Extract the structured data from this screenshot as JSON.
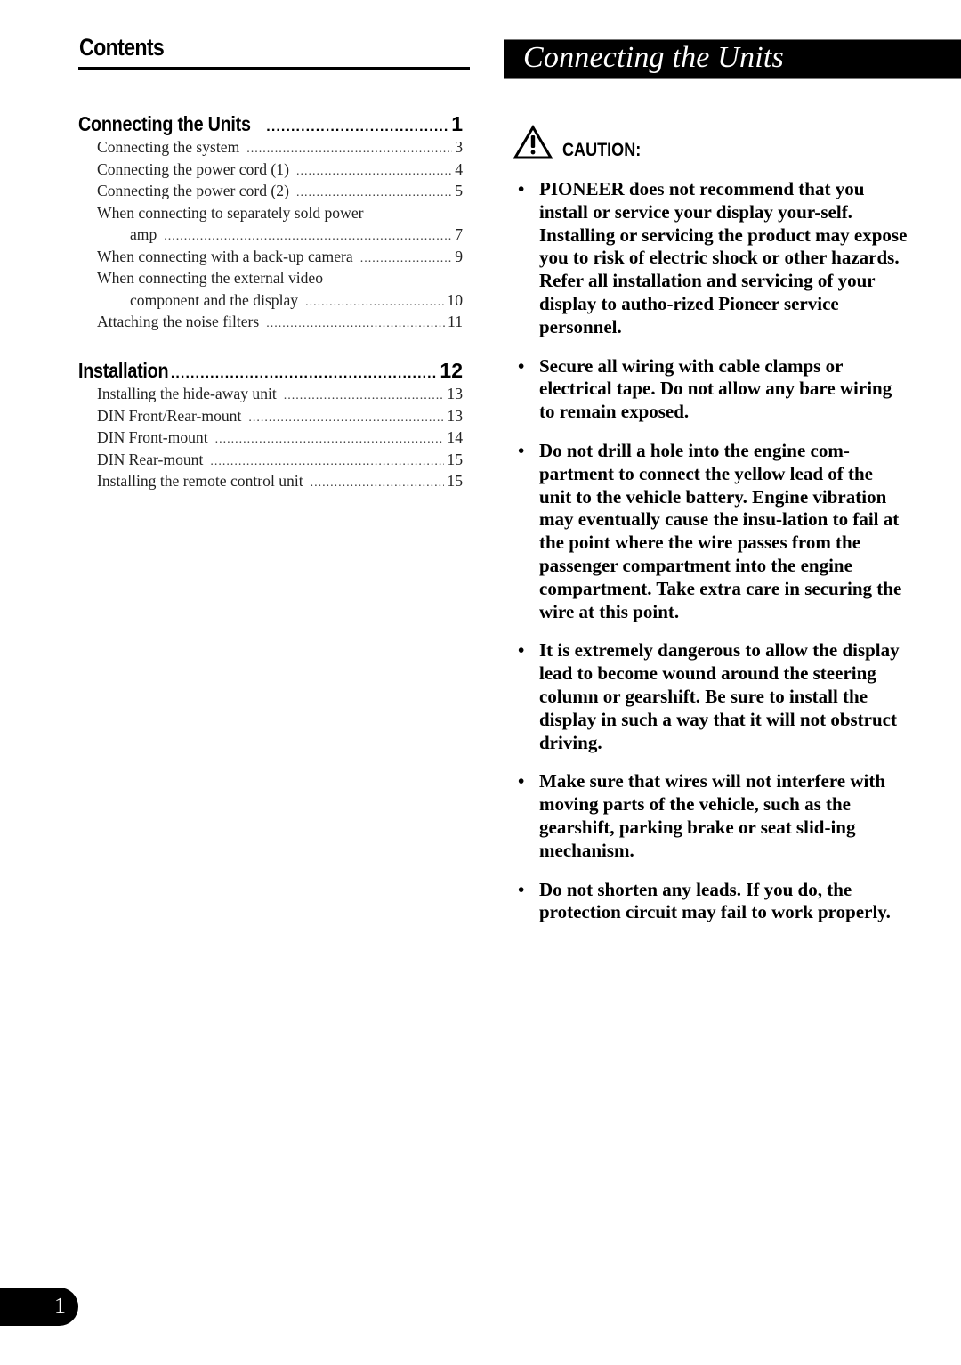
{
  "contents": {
    "title": "Contents",
    "sections": [
      {
        "title": "Connecting the Units",
        "page": "1",
        "items": [
          {
            "label": "Connecting the system",
            "page": "3"
          },
          {
            "label": "Connecting the power cord (1)",
            "page": "4"
          },
          {
            "label": "Connecting the power cord (2)",
            "page": "5"
          },
          {
            "label": "When connecting to separately sold power",
            "continuation": "amp",
            "page": "7"
          },
          {
            "label": "When connecting with a back-up camera",
            "page": "9"
          },
          {
            "label": "When connecting the external video",
            "continuation": "component and the display",
            "page": "10"
          },
          {
            "label": "Attaching the noise filters",
            "page": "11"
          }
        ]
      },
      {
        "title": "Installation",
        "page": "12",
        "items": [
          {
            "label": "Installing the hide-away unit",
            "page": "13"
          },
          {
            "label": "DIN Front/Rear-mount",
            "page": "13"
          },
          {
            "label": "DIN Front-mount",
            "page": "14"
          },
          {
            "label": "DIN Rear-mount",
            "page": "15"
          },
          {
            "label": "Installing the remote control unit",
            "page": "15"
          }
        ]
      }
    ]
  },
  "section_header": {
    "title": "Connecting the Units"
  },
  "caution": {
    "icon": "warning-triangle-icon",
    "label": "CAUTION:",
    "bullet_glyph": "•",
    "items": [
      "PIONEER does not recommend that you install or service your display your-self. Installing or servicing the product may expose you to risk of electric shock or other hazards. Refer all installation and servicing of your display to autho-rized Pioneer service personnel.",
      "Secure all wiring with cable clamps or electrical tape. Do not allow any bare wiring to remain exposed.",
      "Do not drill a hole into the engine com-partment to connect the yellow lead of the unit to the vehicle battery. Engine vibration may eventually cause the insu-lation to fail at the point where the wire passes from the passenger compartment into the engine compartment. Take extra care in securing the wire at this point.",
      "It is extremely dangerous to allow the display lead to become wound around the steering column or gearshift. Be sure to install the display in such a way that it will not obstruct driving.",
      "Make sure that wires will not interfere with moving parts of the vehicle, such as the gearshift, parking brake or seat slid-ing mechanism.",
      "Do not shorten any leads. If you do, the protection circuit may fail to work properly."
    ]
  },
  "leader_dots": "..........................................................................................................................................",
  "page_number": "1"
}
